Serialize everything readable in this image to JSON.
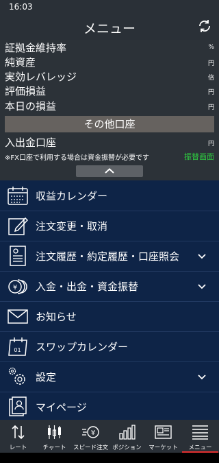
{
  "status_bar": {
    "time": "16:03"
  },
  "header": {
    "title": "メニュー",
    "refresh_icon": "refresh-icon"
  },
  "account_info": {
    "rows": [
      {
        "label": "証拠金維持率",
        "unit": "%"
      },
      {
        "label": "純資産",
        "unit": "円"
      },
      {
        "label": "実効レバレッジ",
        "unit": "倍"
      },
      {
        "label": "評価損益",
        "unit": "円"
      },
      {
        "label": "本日の損益",
        "unit": "円"
      }
    ],
    "section_title": "その他口座",
    "deposit_row": {
      "label": "入出金口座",
      "unit": "円"
    },
    "note": "※FX口座で利用する場合は資金振替が必要です",
    "transfer_link": "振替画面",
    "collapse_icon": "chevron-up-icon"
  },
  "menu_items": [
    {
      "label": "収益カレンダー",
      "icon": "calendar-icon",
      "expandable": false
    },
    {
      "label": "注文変更・取消",
      "icon": "edit-icon",
      "expandable": false
    },
    {
      "label": "注文履歴・約定履歴・口座照会",
      "icon": "document-icon",
      "expandable": true
    },
    {
      "label": "入金・出金・資金振替",
      "icon": "coins-icon",
      "expandable": true
    },
    {
      "label": "お知らせ",
      "icon": "envelope-icon",
      "expandable": false
    },
    {
      "label": "スワップカレンダー",
      "icon": "swap-calendar-icon",
      "expandable": false
    },
    {
      "label": "設定",
      "icon": "gear-icon",
      "expandable": true
    },
    {
      "label": "マイページ",
      "icon": "profile-icon",
      "expandable": false
    }
  ],
  "tabs": [
    {
      "label": "レート",
      "icon": "rate-arrows-icon"
    },
    {
      "label": "チャート",
      "icon": "candlestick-icon"
    },
    {
      "label": "スピード注文",
      "icon": "speed-order-icon"
    },
    {
      "label": "ポジション",
      "icon": "bar-chart-icon"
    },
    {
      "label": "マーケット",
      "icon": "newspaper-icon"
    },
    {
      "label": "メニュー",
      "icon": "menu-lines-icon",
      "active": true
    }
  ],
  "colors": {
    "header_bg": "#2a3037",
    "menu_bg": "#0e2447",
    "link_green": "#2ecc40",
    "active_tab": "#e53030"
  }
}
